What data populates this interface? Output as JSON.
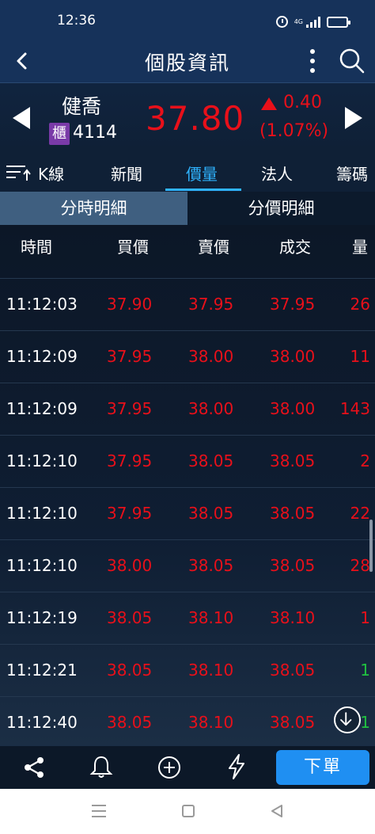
{
  "status": {
    "time": "12:36",
    "network": "4G"
  },
  "header": {
    "title": "個股資訊"
  },
  "stock": {
    "name": "健喬",
    "market_badge": "櫃",
    "code": "4114",
    "price": "37.80",
    "change": "0.40",
    "change_pct": "(1.07%)"
  },
  "tabs": [
    {
      "label": "K線"
    },
    {
      "label": "新聞"
    },
    {
      "label": "價量",
      "active": true
    },
    {
      "label": "法人"
    },
    {
      "label": "籌碼"
    }
  ],
  "subtabs": [
    {
      "label": "分時明細",
      "active": true
    },
    {
      "label": "分價明細",
      "active": false
    }
  ],
  "table": {
    "headers": [
      "時間",
      "買價",
      "賣價",
      "成交",
      "量"
    ],
    "rows": [
      {
        "time": "11:12:03",
        "bid": "37.90",
        "ask": "37.95",
        "deal": "37.95",
        "vol": "26",
        "vol_color": "red"
      },
      {
        "time": "11:12:09",
        "bid": "37.95",
        "ask": "38.00",
        "deal": "38.00",
        "vol": "11",
        "vol_color": "red"
      },
      {
        "time": "11:12:09",
        "bid": "37.95",
        "ask": "38.00",
        "deal": "38.00",
        "vol": "143",
        "vol_color": "red"
      },
      {
        "time": "11:12:10",
        "bid": "37.95",
        "ask": "38.05",
        "deal": "38.05",
        "vol": "2",
        "vol_color": "red"
      },
      {
        "time": "11:12:10",
        "bid": "37.95",
        "ask": "38.05",
        "deal": "38.05",
        "vol": "22",
        "vol_color": "red"
      },
      {
        "time": "11:12:10",
        "bid": "38.00",
        "ask": "38.05",
        "deal": "38.05",
        "vol": "28",
        "vol_color": "red"
      },
      {
        "time": "11:12:19",
        "bid": "38.05",
        "ask": "38.10",
        "deal": "38.10",
        "vol": "1",
        "vol_color": "red"
      },
      {
        "time": "11:12:21",
        "bid": "38.05",
        "ask": "38.10",
        "deal": "38.05",
        "vol": "1",
        "vol_color": "green"
      },
      {
        "time": "11:12:40",
        "bid": "38.05",
        "ask": "38.10",
        "deal": "38.05",
        "vol": "1",
        "vol_color": "green"
      }
    ]
  },
  "bottom": {
    "order_label": "下單"
  },
  "colors": {
    "up": "#e8101a",
    "down": "#20c040",
    "accent": "#2fb3ff",
    "header_bg": "#16325a",
    "order_button": "#1f8ff2"
  },
  "icons": [
    "back-icon",
    "more-icon",
    "search-icon",
    "prev-stock-icon",
    "next-stock-icon",
    "kline-icon",
    "scroll-down-icon",
    "share-icon",
    "bell-icon",
    "add-icon",
    "flash-icon"
  ]
}
